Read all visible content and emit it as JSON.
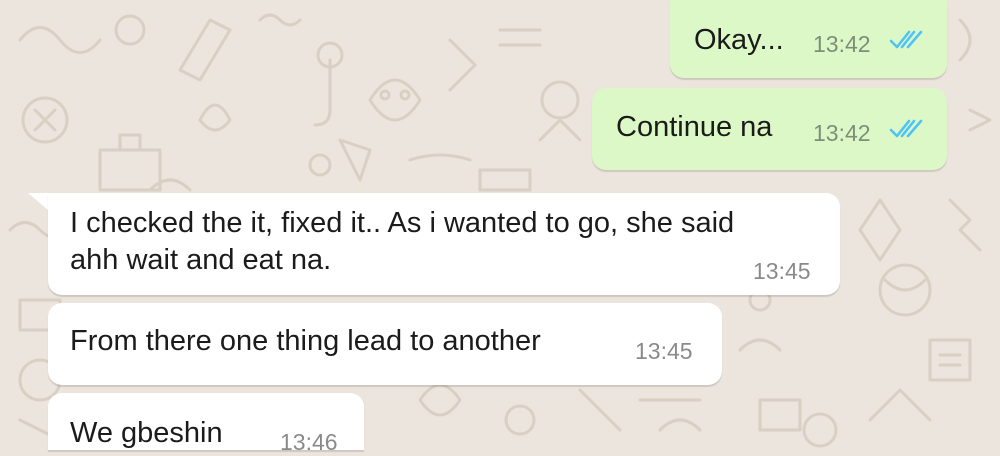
{
  "colors": {
    "outgoing_bubble": "#dcf8c6",
    "incoming_bubble": "#ffffff",
    "wallpaper": "#ece5dd",
    "read_ticks": "#4fc3f7",
    "timestamp": "#8a8a8a"
  },
  "messages": [
    {
      "direction": "outgoing",
      "text": "Okay...",
      "time": "13:42",
      "status": "read",
      "status_icon": "double-check-icon"
    },
    {
      "direction": "outgoing",
      "text": "Continue na",
      "time": "13:42",
      "status": "read",
      "status_icon": "double-check-icon"
    },
    {
      "direction": "incoming",
      "lines": [
        "I checked the it, fixed it.. As i wanted to go, she said",
        "ahh wait and eat na."
      ],
      "time": "13:45"
    },
    {
      "direction": "incoming",
      "text": "From there one thing lead to another",
      "time": "13:45"
    },
    {
      "direction": "incoming",
      "text": "We gbeshin",
      "time": "13:46"
    }
  ]
}
